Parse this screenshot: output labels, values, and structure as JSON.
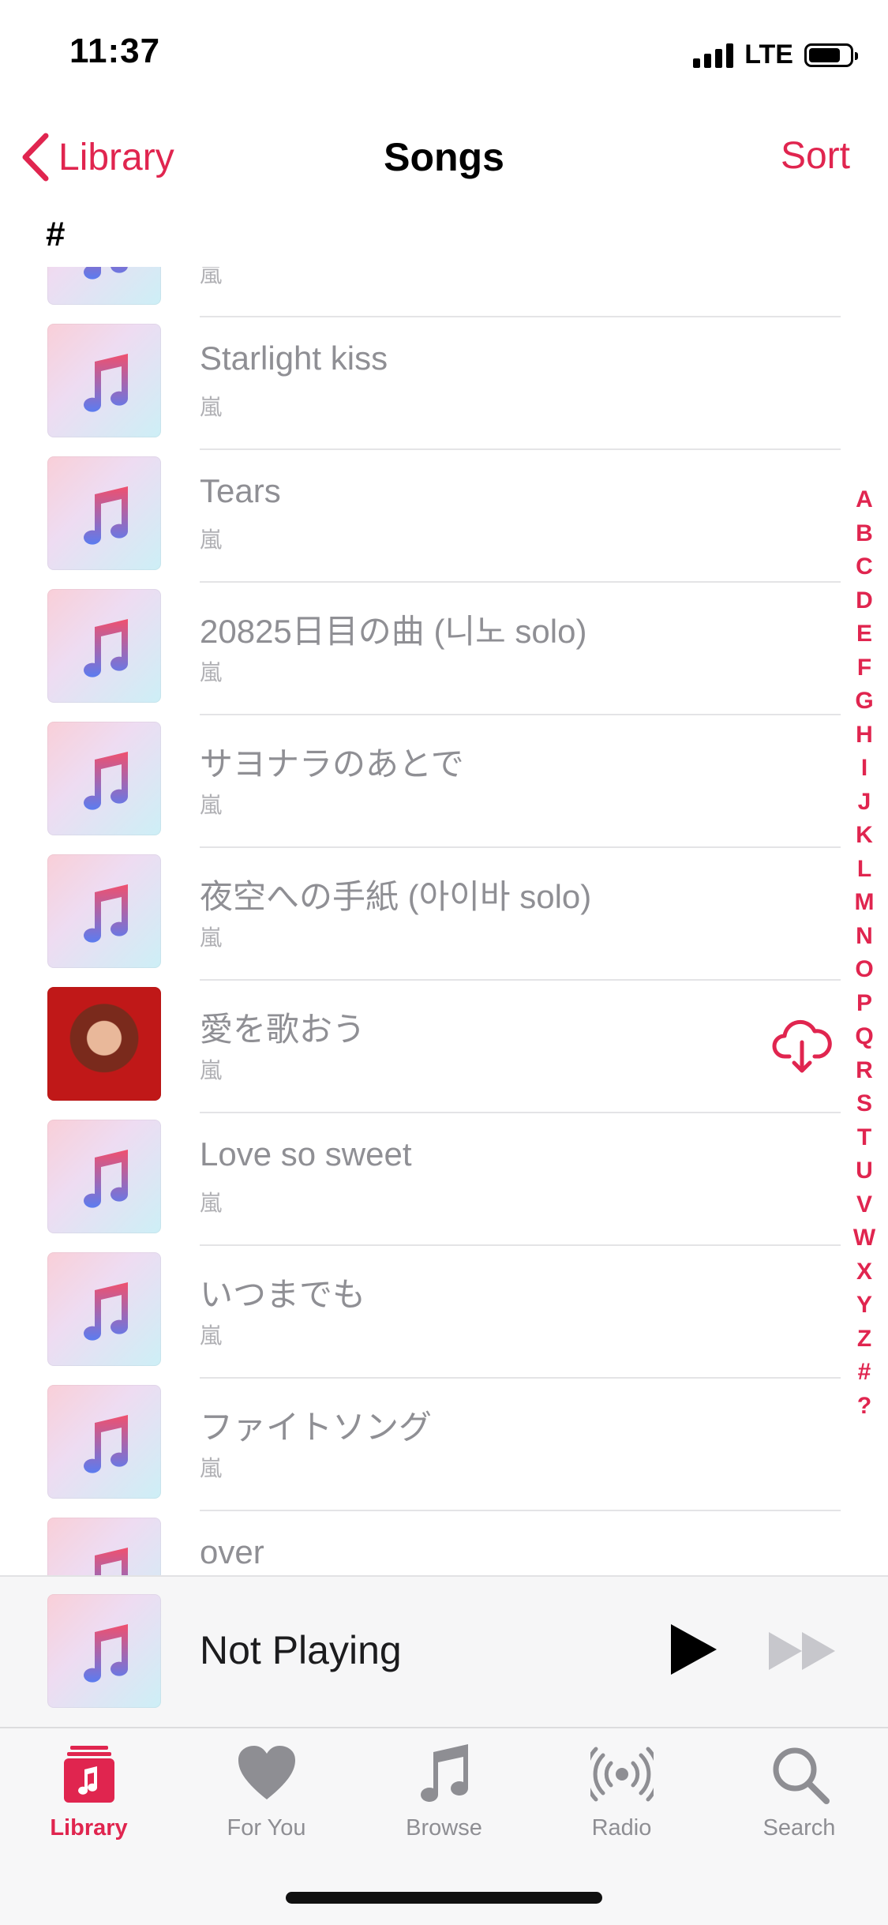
{
  "status_bar": {
    "time": "11:37",
    "network": "LTE"
  },
  "nav": {
    "back_label": "Library",
    "title": "Songs",
    "sort_label": "Sort"
  },
  "section_header": "#",
  "songs": [
    {
      "title": "",
      "artist": "嵐",
      "artwork": "music-note-placeholder"
    },
    {
      "title": "Starlight kiss",
      "artist": "嵐",
      "artwork": "music-note-placeholder"
    },
    {
      "title": "Tears",
      "artist": "嵐",
      "artwork": "music-note-placeholder"
    },
    {
      "title": "20825日目の曲 (니노 solo)",
      "artist": "嵐",
      "artwork": "music-note-placeholder"
    },
    {
      "title": "サヨナラのあとで",
      "artist": "嵐",
      "artwork": "music-note-placeholder"
    },
    {
      "title": "夜空への手紙 (아이바 solo)",
      "artist": "嵐",
      "artwork": "music-note-placeholder"
    },
    {
      "title": "愛を歌おう",
      "artist": "嵐",
      "artwork": "album-photo",
      "downloadable": true
    },
    {
      "title": "Love so sweet",
      "artist": "嵐",
      "artwork": "music-note-placeholder"
    },
    {
      "title": "いつまでも",
      "artist": "嵐",
      "artwork": "music-note-placeholder"
    },
    {
      "title": "ファイトソング",
      "artist": "嵐",
      "artwork": "music-note-placeholder"
    },
    {
      "title": "over",
      "artist": "",
      "artwork": "music-note-placeholder"
    }
  ],
  "index_letters": [
    "A",
    "B",
    "C",
    "D",
    "E",
    "F",
    "G",
    "H",
    "I",
    "J",
    "K",
    "L",
    "M",
    "N",
    "O",
    "P",
    "Q",
    "R",
    "S",
    "T",
    "U",
    "V",
    "W",
    "X",
    "Y",
    "Z",
    "#",
    "?"
  ],
  "mini_player": {
    "title": "Not Playing"
  },
  "tabs": [
    {
      "label": "Library",
      "icon": "library-icon",
      "active": true
    },
    {
      "label": "For You",
      "icon": "heart-icon",
      "active": false
    },
    {
      "label": "Browse",
      "icon": "music-note-icon",
      "active": false
    },
    {
      "label": "Radio",
      "icon": "radio-icon",
      "active": false
    },
    {
      "label": "Search",
      "icon": "search-icon",
      "active": false
    }
  ],
  "colors": {
    "accent": "#e0254f",
    "inactive": "#8e8e93"
  }
}
